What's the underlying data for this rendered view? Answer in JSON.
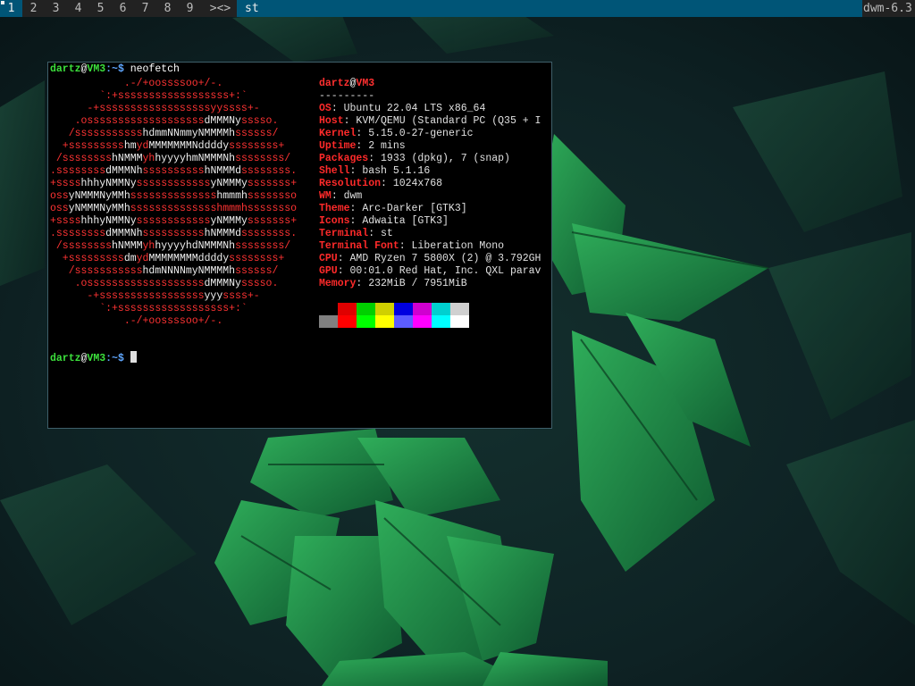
{
  "bar": {
    "tags": [
      "1",
      "2",
      "3",
      "4",
      "5",
      "6",
      "7",
      "8",
      "9"
    ],
    "selected_tag": "1",
    "layout_symbol": "><>",
    "window_title": "st",
    "status": "dwm-6.3"
  },
  "terminal": {
    "prompt_user": "dartz",
    "prompt_at": "@",
    "prompt_host": "VM3",
    "prompt_rest": ":~$ ",
    "command": "neofetch",
    "header_user": "dartz",
    "header_at": "@",
    "header_host": "VM3",
    "separator": "---------",
    "info": [
      {
        "key": "OS",
        "value": ": Ubuntu 22.04 LTS x86_64"
      },
      {
        "key": "Host",
        "value": ": KVM/QEMU (Standard PC (Q35 + I"
      },
      {
        "key": "Kernel",
        "value": ": 5.15.0-27-generic"
      },
      {
        "key": "Uptime",
        "value": ": 2 mins"
      },
      {
        "key": "Packages",
        "value": ": 1933 (dpkg), 7 (snap)"
      },
      {
        "key": "Shell",
        "value": ": bash 5.1.16"
      },
      {
        "key": "Resolution",
        "value": ": 1024x768"
      },
      {
        "key": "WM",
        "value": ": dwm"
      },
      {
        "key": "Theme",
        "value": ": Arc-Darker [GTK3]"
      },
      {
        "key": "Icons",
        "value": ": Adwaita [GTK3]"
      },
      {
        "key": "Terminal",
        "value": ": st"
      },
      {
        "key": "Terminal Font",
        "value": ": Liberation Mono"
      },
      {
        "key": "CPU",
        "value": ": AMD Ryzen 7 5800X (2) @ 3.792GH"
      },
      {
        "key": "GPU",
        "value": ": 00:01.0 Red Hat, Inc. QXL parav"
      },
      {
        "key": "Memory",
        "value": ": 232MiB / 7951MiB"
      }
    ],
    "ascii": [
      [
        [
          "r",
          "            .-/+oossssoo+/-."
        ]
      ],
      [
        [
          "r",
          "        `:+ssssssssssssssssss+:`"
        ]
      ],
      [
        [
          "r",
          "      -+ssssssssssssssssssyyssss+-"
        ]
      ],
      [
        [
          "r",
          "    .osssssssssssssssssss"
        ],
        [
          "w",
          "dMMMNy"
        ],
        [
          "r",
          "sssso."
        ]
      ],
      [
        [
          "r",
          "   /sssssssssss"
        ],
        [
          "w",
          "hdmmNNmmyNMMMMh"
        ],
        [
          "r",
          "ssssss/"
        ]
      ],
      [
        [
          "r",
          "  +sssssssss"
        ],
        [
          "w",
          "hm"
        ],
        [
          "r",
          "yd"
        ],
        [
          "w",
          "MMMMMMMNddddy"
        ],
        [
          "r",
          "ssssssss+"
        ]
      ],
      [
        [
          "r",
          " /ssssssss"
        ],
        [
          "w",
          "hNMMM"
        ],
        [
          "r",
          "yh"
        ],
        [
          "w",
          "hyyyyhmNMMMNh"
        ],
        [
          "r",
          "ssssssss/"
        ]
      ],
      [
        [
          "r",
          ".ssssssss"
        ],
        [
          "w",
          "dMMMNh"
        ],
        [
          "r",
          "ssssssssss"
        ],
        [
          "w",
          "hNMMMd"
        ],
        [
          "r",
          "ssssssss."
        ]
      ],
      [
        [
          "r",
          "+ssss"
        ],
        [
          "w",
          "hhhyNMMNy"
        ],
        [
          "r",
          "ssssssssssss"
        ],
        [
          "w",
          "yNMMMy"
        ],
        [
          "r",
          "sssssss+"
        ]
      ],
      [
        [
          "r",
          "oss"
        ],
        [
          "w",
          "yNMMMNyMMh"
        ],
        [
          "r",
          "ssssssssssssss"
        ],
        [
          "w",
          "hmmmh"
        ],
        [
          "r",
          "ssssssso"
        ]
      ],
      [
        [
          "r",
          "oss"
        ],
        [
          "w",
          "yNMMMNyMMh"
        ],
        [
          "r",
          "sssssssssssssshmmmhssssssso"
        ]
      ],
      [
        [
          "r",
          "+ssss"
        ],
        [
          "w",
          "hhhyNMMNy"
        ],
        [
          "r",
          "ssssssssssss"
        ],
        [
          "w",
          "yNMMMy"
        ],
        [
          "r",
          "sssssss+"
        ]
      ],
      [
        [
          "r",
          ".ssssssss"
        ],
        [
          "w",
          "dMMMNh"
        ],
        [
          "r",
          "ssssssssss"
        ],
        [
          "w",
          "hNMMMd"
        ],
        [
          "r",
          "ssssssss."
        ]
      ],
      [
        [
          "r",
          " /ssssssss"
        ],
        [
          "w",
          "hNMMM"
        ],
        [
          "r",
          "yh"
        ],
        [
          "w",
          "hyyyyhdNMMMNh"
        ],
        [
          "r",
          "ssssssss/"
        ]
      ],
      [
        [
          "r",
          "  +sssssssss"
        ],
        [
          "w",
          "dm"
        ],
        [
          "r",
          "yd"
        ],
        [
          "w",
          "MMMMMMMMddddy"
        ],
        [
          "r",
          "ssssssss+"
        ]
      ],
      [
        [
          "r",
          "   /sssssssssss"
        ],
        [
          "w",
          "hdmNNNNmyNMMMMh"
        ],
        [
          "r",
          "ssssss/"
        ]
      ],
      [
        [
          "r",
          "    .osssssssssssssssssss"
        ],
        [
          "w",
          "dMMMNy"
        ],
        [
          "r",
          "sssso."
        ]
      ],
      [
        [
          "r",
          "      -+sssssssssssssssss"
        ],
        [
          "w",
          "yyy"
        ],
        [
          "r",
          "ssss+-"
        ]
      ],
      [
        [
          "r",
          "        `:+ssssssssssssssssss+:`"
        ]
      ],
      [
        [
          "r",
          "            .-/+oossssoo+/-."
        ]
      ]
    ],
    "palette": {
      "top": [
        "#000000",
        "#e00000",
        "#00d000",
        "#d0d000",
        "#0000e0",
        "#d000d0",
        "#00d0d0",
        "#d0d0d0"
      ],
      "bottom": [
        "#808080",
        "#ff0000",
        "#00ff00",
        "#ffff00",
        "#5c5cff",
        "#ff00ff",
        "#00ffff",
        "#ffffff"
      ]
    }
  },
  "colors": {
    "bar_bg": "#222222",
    "bar_selected": "#005577",
    "prompt_green": "#3ce03c",
    "neofetch_red": "#ff2a2a"
  }
}
